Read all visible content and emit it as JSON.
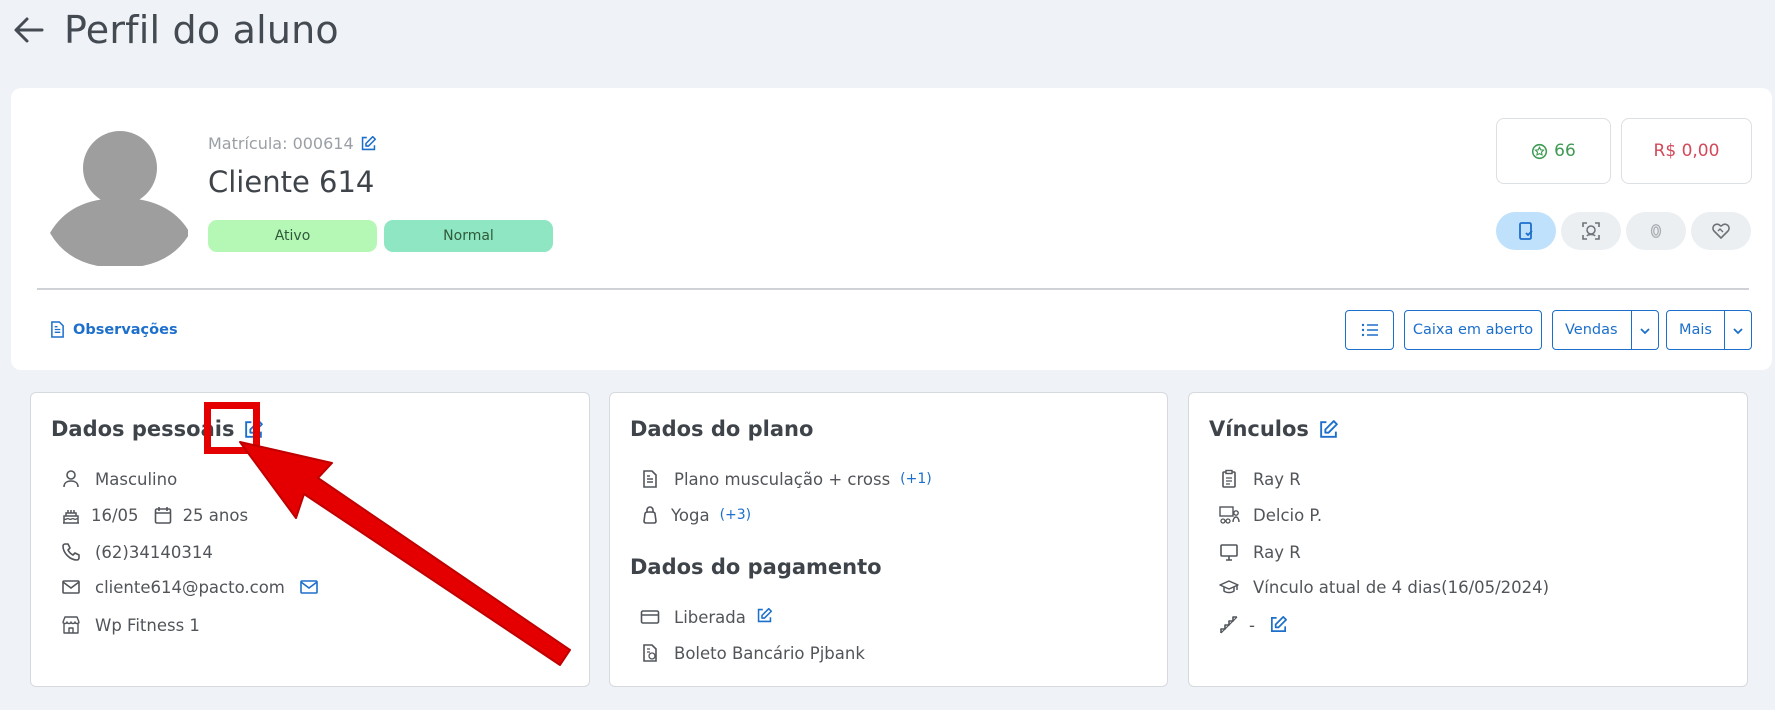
{
  "header": {
    "title": "Perfil do aluno"
  },
  "profile": {
    "matricula_label": "Matrícula: 000614",
    "name": "Cliente 614",
    "status": "Ativo",
    "category": "Normal",
    "points": "66",
    "balance": "R$ 0,00"
  },
  "actions": {
    "observacoes": "Observações",
    "caixa": "Caixa em aberto",
    "vendas": "Vendas",
    "mais": "Mais"
  },
  "personal": {
    "title": "Dados pessoais",
    "gender": "Masculino",
    "birthday": "16/05",
    "age": "25 anos",
    "phone": "(62)34140314",
    "email": "cliente614@pacto.com",
    "unit": "Wp Fitness 1"
  },
  "plan": {
    "title": "Dados do plano",
    "plan_name": "Plano musculação + cross",
    "plan_extra": "(+1)",
    "modality": "Yoga",
    "modality_extra": "(+3)",
    "payment_title": "Dados do pagamento",
    "payment_status": "Liberada",
    "payment_method": "Boleto Bancário Pjbank"
  },
  "links": {
    "title": "Vínculos",
    "consultant": "Ray R",
    "professor": "Delcio P.",
    "trainer": "Ray R",
    "bond_duration": "Vínculo atual de 4 dias(16/05/2024)",
    "level": "-"
  },
  "colors": {
    "accent": "#1d6fcc",
    "annotation": "#e40000",
    "points": "#3f9a54",
    "balance": "#d2495a"
  }
}
